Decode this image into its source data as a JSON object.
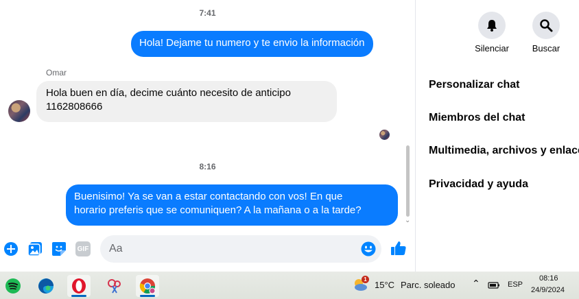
{
  "chat": {
    "time1": "7:41",
    "outgoing1": "Hola! Dejame tu numero y te envio la información",
    "sender_name": "Omar",
    "incoming1_line1": "Hola buen en día, decime cuánto necesito de anticipo",
    "incoming1_line2": "1162808666",
    "time2": "8:16",
    "outgoing2_line1": "Buenisimo! Ya se van a estar contactando con vos! En que",
    "outgoing2_line2": "horario preferis que se comuniquen? A la mañana o a la tarde?"
  },
  "composer": {
    "placeholder": "Aa",
    "gif_label": "GIF"
  },
  "side": {
    "mute_label": "Silenciar",
    "search_label": "Buscar",
    "menu": [
      "Personalizar chat",
      "Miembros del chat",
      "Multimedia, archivos y enlaces",
      "Privacidad y ayuda"
    ]
  },
  "taskbar": {
    "weather_temp": "15°C",
    "weather_desc": "Parc. soleado",
    "weather_alert": "1",
    "language": "ESP",
    "time": "08:16",
    "date": "24/9/2024"
  },
  "colors": {
    "messenger_blue": "#0a7cff",
    "bubble_grey": "#f0f0f0",
    "icon_blue": "#0084ff"
  },
  "icons": [
    "plus-circle-icon",
    "photo-icon",
    "sticker-icon",
    "gif-icon",
    "emoji-icon",
    "thumbs-up-icon",
    "bell-icon",
    "search-icon"
  ]
}
